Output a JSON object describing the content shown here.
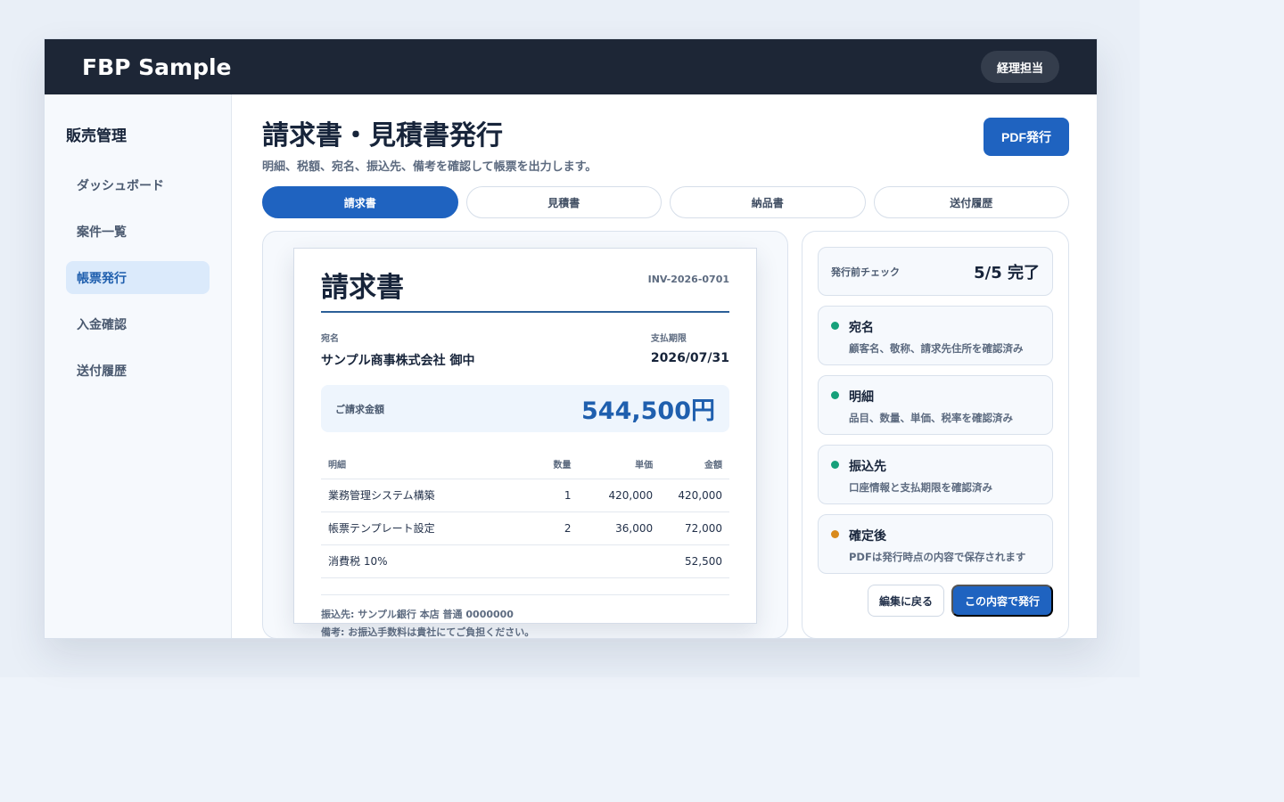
{
  "app": {
    "brand": "FBP Sample",
    "role_badge": "経理担当"
  },
  "sidebar": {
    "title": "販売管理",
    "items": [
      {
        "label": "ダッシュボード",
        "active": false
      },
      {
        "label": "案件一覧",
        "active": false
      },
      {
        "label": "帳票発行",
        "active": true
      },
      {
        "label": "入金確認",
        "active": false
      },
      {
        "label": "送付履歴",
        "active": false
      }
    ]
  },
  "main": {
    "title": "請求書・見積書発行",
    "subtitle": "明細、税額、宛名、振込先、備考を確認して帳票を出力します。",
    "pdf_button": "PDF発行",
    "tabs": [
      {
        "label": "請求書",
        "active": true
      },
      {
        "label": "見積書",
        "active": false
      },
      {
        "label": "納品書",
        "active": false
      },
      {
        "label": "送付履歴",
        "active": false
      }
    ]
  },
  "invoice": {
    "title": "請求書",
    "number": "INV-2026-0701",
    "recipient_label": "宛名",
    "recipient": "サンプル商事株式会社 御中",
    "due_label": "支払期限",
    "due_date": "2026/07/31",
    "amount_label": "ご請求金額",
    "amount": "544,500円",
    "columns": [
      "明細",
      "数量",
      "単価",
      "金額"
    ],
    "rows": [
      {
        "item": "業務管理システム構築",
        "qty": "1",
        "price": "420,000",
        "amount": "420,000"
      },
      {
        "item": "帳票テンプレート設定",
        "qty": "2",
        "price": "36,000",
        "amount": "72,000"
      },
      {
        "item": "消費税 10%",
        "qty": "",
        "price": "",
        "amount": "52,500"
      }
    ],
    "bank": "振込先: サンプル銀行 本店 普通 0000000",
    "note": "備考: お振込手数料は貴社にてご負担ください。"
  },
  "checks": {
    "label": "発行前チェック",
    "score": "5/5 完了",
    "items": [
      {
        "title": "宛名",
        "desc": "顧客名、敬称、請求先住所を確認済み",
        "color": "#16a07a"
      },
      {
        "title": "明細",
        "desc": "品目、数量、単価、税率を確認済み",
        "color": "#16a07a"
      },
      {
        "title": "振込先",
        "desc": "口座情報と支払期限を確認済み",
        "color": "#16a07a"
      },
      {
        "title": "確定後",
        "desc": "PDFは発行時点の内容で保存されます",
        "color": "#d98a1c"
      }
    ],
    "back_button": "編集に戻る",
    "issue_button": "この内容で発行"
  }
}
